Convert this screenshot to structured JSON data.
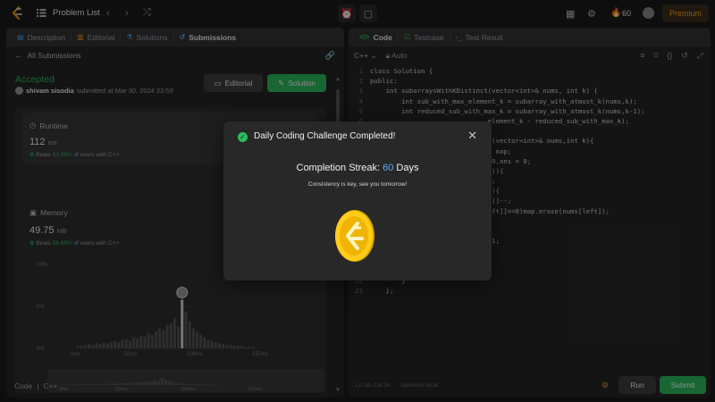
{
  "topbar": {
    "title": "Problem List",
    "streak": "60",
    "premium": "Premium"
  },
  "left_panel": {
    "tabs": [
      {
        "label": "Description"
      },
      {
        "label": "Editorial"
      },
      {
        "label": "Solutions"
      },
      {
        "label": "Submissions"
      }
    ],
    "back_label": "All Submissions",
    "status": "Accepted",
    "user": "shivam sisodia",
    "submitted": "submitted at Mar 30, 2024 23:59",
    "editorial_btn": "Editorial",
    "solution_btn": "Solution",
    "runtime": {
      "label": "Runtime",
      "value": "112",
      "unit": "ms",
      "beats_pre": "Beats",
      "beats_pct": "51.06%",
      "beats_post": "of users with C++"
    },
    "memory": {
      "label": "Memory",
      "value": "49.75",
      "unit": "MB",
      "beats_pre": "Beats",
      "beats_pct": "56.66%",
      "beats_post": "of users with C++"
    },
    "chart_y_ticks": [
      "10%",
      "5%",
      "0%"
    ],
    "chart_x_ticks": [
      "0ms",
      "50ms",
      "108ms",
      "157ms"
    ],
    "footer_code": "Code",
    "footer_lang": "C++"
  },
  "right_panel": {
    "tabs": [
      {
        "label": "Code"
      },
      {
        "label": "Testcase"
      },
      {
        "label": "Test Result"
      }
    ],
    "language": "C++",
    "mode": "Auto",
    "code_lines": [
      {
        "n": "1",
        "t": "class Solution {"
      },
      {
        "n": "2",
        "t": "public:"
      },
      {
        "n": "3",
        "t": "    int subarraysWithKDistinct(vector<int>& nums, int k) {"
      },
      {
        "n": "4",
        "t": "        int sub_with_max_element_k = subarray_with_atmost_k(nums,k);"
      },
      {
        "n": "5",
        "t": "        int reduced_sub_with_max_k = subarray_with_atmost_k(nums,k-1);"
      },
      {
        "n": "6",
        "t": "                              element_k - reduced_sub_with_max_k);"
      },
      {
        "n": "7",
        "t": ""
      },
      {
        "n": "8",
        "t": "                             _k(vector<int>& nums,int k){"
      },
      {
        "n": "9",
        "t": "                             t> map;"
      },
      {
        "n": "10",
        "t": "                             = 0,ans = 0;"
      },
      {
        "n": "11",
        "t": "                             e()){"
      },
      {
        "n": "12",
        "t": "                             ++;"
      },
      {
        "n": "13",
        "t": "                             >k){"
      },
      {
        "n": "14",
        "t": "                             ft]]--;"
      },
      {
        "n": "15",
        "t": "                             left]]==0)map.erase(nums[left]);"
      },
      {
        "n": "16",
        "t": ""
      },
      {
        "n": "17",
        "t": ""
      },
      {
        "n": "18",
        "t": "                             t+1;"
      },
      {
        "n": "19",
        "t": ""
      },
      {
        "n": "20",
        "t": ""
      },
      {
        "n": "21",
        "t": ""
      },
      {
        "n": "22",
        "t": "        }"
      },
      {
        "n": "23",
        "t": "    };"
      }
    ],
    "status_pos": "Ln 18, Col 34",
    "status_saved": "Saved to local",
    "run": "Run",
    "submit": "Submit"
  },
  "modal": {
    "title": "Daily Coding Challenge Completed!",
    "streak_pre": "Completion Streak:",
    "streak_num": "60",
    "streak_post": "Days",
    "subtitle": "Consistency is key, see you tomorrow!"
  },
  "chart_data": {
    "type": "bar",
    "x_ticks": [
      "0ms",
      "50ms",
      "108ms",
      "157ms"
    ],
    "y_ticks": [
      "10%",
      "5%",
      "0%"
    ],
    "ylim": [
      0,
      10
    ],
    "values": [
      0.3,
      0.3,
      0.4,
      0.5,
      0.4,
      0.6,
      0.5,
      0.7,
      0.6,
      0.8,
      0.9,
      0.7,
      1.0,
      1.1,
      0.9,
      1.3,
      1.2,
      1.5,
      1.4,
      1.8,
      1.6,
      2.0,
      2.4,
      2.2,
      2.8,
      3.0,
      3.6,
      2.6,
      5.8,
      4.4,
      3.2,
      2.4,
      2.0,
      1.6,
      1.3,
      1.0,
      0.9,
      0.7,
      0.6,
      0.5,
      0.4,
      0.4,
      0.3,
      0.3,
      0.3,
      0.2,
      0.2,
      0.2
    ],
    "highlight_index": 28,
    "colors": {
      "bar": "#555555",
      "highlight": "#d9d9d9"
    }
  }
}
